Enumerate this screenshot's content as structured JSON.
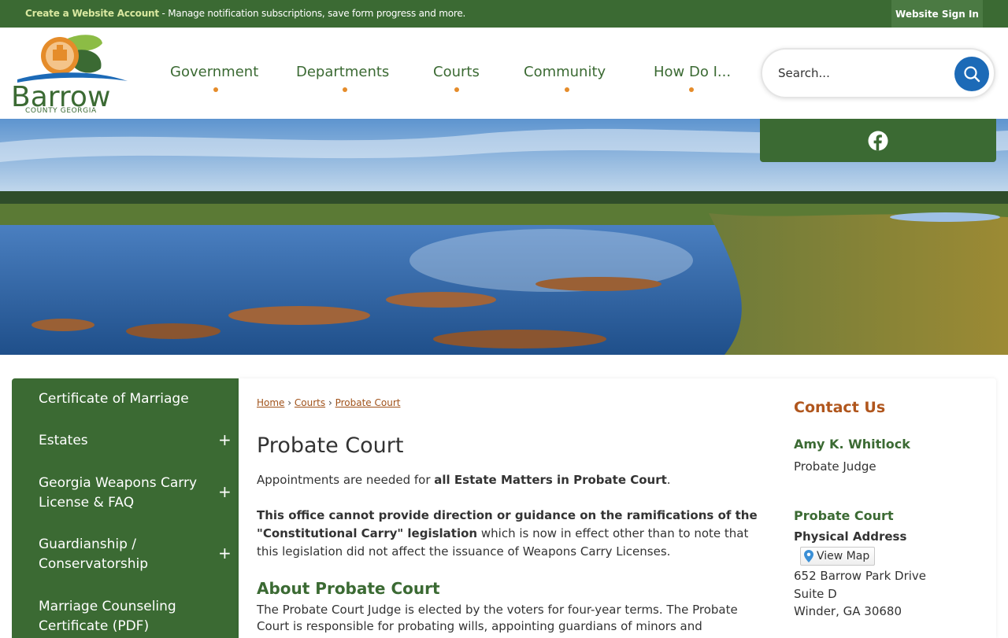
{
  "topbar": {
    "account_link": "Create a Website Account",
    "account_desc": " - Manage notification subscriptions, save form progress and more.",
    "signin": "Website Sign In"
  },
  "logo": {
    "name": "Barrow",
    "tagline": "COUNTY GEORGIA"
  },
  "nav": {
    "items": [
      "Government",
      "Departments",
      "Courts",
      "Community",
      "How Do I..."
    ]
  },
  "search": {
    "placeholder": "Search..."
  },
  "social": {
    "icon": "facebook-icon"
  },
  "sidebar": {
    "items": [
      {
        "label": "Certificate of Marriage",
        "expandable": false
      },
      {
        "label": "Estates",
        "expandable": true
      },
      {
        "label": "Georgia Weapons Carry License & FAQ",
        "expandable": true
      },
      {
        "label": "Guardianship / Conservatorship",
        "expandable": true
      },
      {
        "label": "Marriage Counseling Certificate (PDF)",
        "expandable": false
      }
    ],
    "expand_symbol": "+"
  },
  "breadcrumb": {
    "home": "Home",
    "courts": "Courts",
    "current": "Probate Court",
    "sep": "›"
  },
  "main": {
    "title": "Probate Court",
    "p1_text": "Appointments are needed for ",
    "p1_bold": "all Estate Matters in Probate Court",
    "p1_end": ".",
    "p2_bold": "This office cannot provide direction or guidance on the ramifications of the \"Constitutional Carry\" legislation",
    "p2_text": " which is now in effect other than to note that this legislation did not affect the issuance of Weapons Carry Licenses.",
    "about_title": "About Probate Court",
    "about_text": "The Probate Court Judge is elected by the voters for four-year terms. The Probate Court is responsible for probating wills, appointing guardians of minors and"
  },
  "contact": {
    "title": "Contact Us",
    "name": "Amy K. Whitlock",
    "role": "Probate Judge",
    "dept": "Probate Court",
    "address_label": "Physical Address",
    "map_button": "View Map",
    "address_lines": [
      "652 Barrow Park Drive",
      "Suite D",
      "Winder, GA 30680"
    ]
  },
  "colors": {
    "brand_green": "#3b6a33",
    "accent_orange": "#e58c2a",
    "search_blue": "#1c6ab7",
    "contact_title": "#b0561d"
  }
}
